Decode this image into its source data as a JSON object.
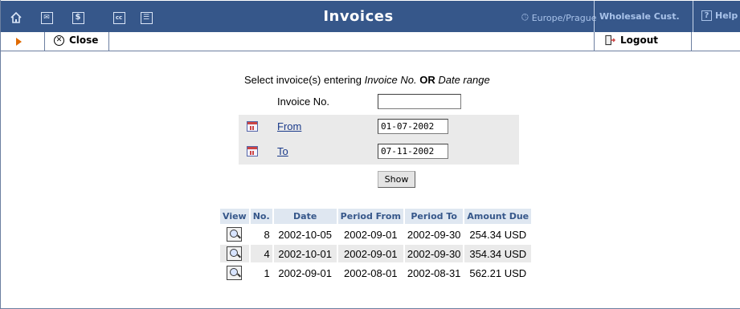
{
  "header": {
    "title": "Invoices",
    "timezone": "Europe/Prague",
    "customer": "Wholesale Cust.",
    "help_label": "Help",
    "icons": [
      "home-icon",
      "mail-icon",
      "billing-icon",
      "credit-card-icon",
      "list-icon"
    ]
  },
  "toolbar": {
    "close_label": "Close",
    "logout_label": "Logout"
  },
  "form": {
    "instructions_prefix": "Select invoice(s) entering ",
    "instructions_field1": "Invoice No.",
    "instructions_or": " OR ",
    "instructions_field2": "Date range",
    "invoice_no_label": "Invoice No.",
    "invoice_no_value": "",
    "from_label": "From",
    "from_value": "01-07-2002",
    "to_label": "To",
    "to_value": "07-11-2002",
    "show_label": "Show"
  },
  "invoices": {
    "columns": [
      "View",
      "No.",
      "Date",
      "Period From",
      "Period To",
      "Amount Due"
    ],
    "rows": [
      {
        "no": "8",
        "date": "2002-10-05",
        "period_from": "2002-09-01",
        "period_to": "2002-09-30",
        "amount": "254.34 USD"
      },
      {
        "no": "4",
        "date": "2002-10-01",
        "period_from": "2002-09-01",
        "period_to": "2002-09-30",
        "amount": "354.34 USD"
      },
      {
        "no": "1",
        "date": "2002-09-01",
        "period_from": "2002-08-01",
        "period_to": "2002-08-31",
        "amount": "562.21 USD"
      }
    ]
  },
  "colors": {
    "header_bg": "#36578a",
    "header_accent": "#a9c3ea",
    "table_header_bg": "#dfe7f1",
    "row_shade": "#eaeaea",
    "arrow": "#e06a00"
  }
}
